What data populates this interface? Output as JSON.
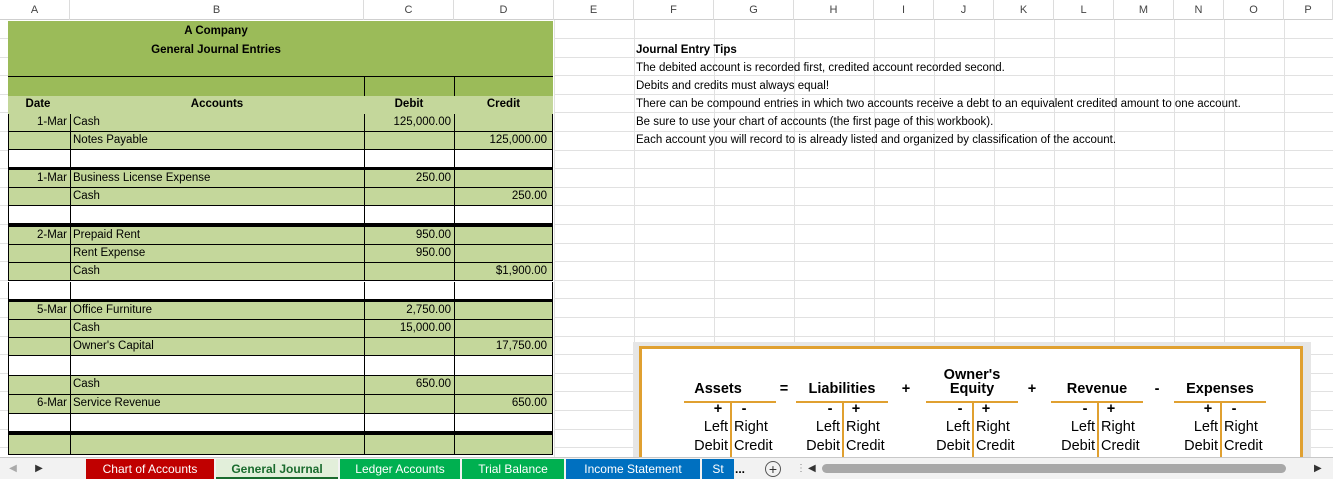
{
  "columns": [
    "A",
    "B",
    "C",
    "D",
    "E",
    "F",
    "G",
    "H",
    "I",
    "J",
    "K",
    "L",
    "M",
    "N",
    "O",
    "P"
  ],
  "journal": {
    "company": "A Company",
    "subtitle": "General Journal Entries",
    "headers": {
      "date": "Date",
      "accounts": "Accounts",
      "debit": "Debit",
      "credit": "Credit"
    },
    "rows": [
      {
        "date": "1-Mar",
        "account": "Cash",
        "debit": "125,000.00",
        "credit": ""
      },
      {
        "date": "",
        "account": "Notes Payable",
        "debit": "",
        "credit": "125,000.00"
      },
      {
        "date": "1-Mar",
        "account": "Business License Expense",
        "debit": "250.00",
        "credit": ""
      },
      {
        "date": "",
        "account": "Cash",
        "debit": "",
        "credit": "250.00"
      },
      {
        "date": "2-Mar",
        "account": "Prepaid Rent",
        "debit": "950.00",
        "credit": ""
      },
      {
        "date": "",
        "account": "Rent Expense",
        "debit": "950.00",
        "credit": ""
      },
      {
        "date": "",
        "account": "Cash",
        "debit": "",
        "credit": "$1,900.00"
      },
      {
        "date": "5-Mar",
        "account": "Office Furniture",
        "debit": "2,750.00",
        "credit": ""
      },
      {
        "date": "",
        "account": "Cash",
        "debit": "15,000.00",
        "credit": ""
      },
      {
        "date": "",
        "account": "Owner's Capital",
        "debit": "",
        "credit": "17,750.00"
      },
      {
        "date": "",
        "account": "Cash",
        "debit": "650.00",
        "credit": ""
      },
      {
        "date": "6-Mar",
        "account": "Service Revenue",
        "debit": "",
        "credit": "650.00"
      }
    ]
  },
  "tips": {
    "title": "Journal Entry Tips",
    "lines": [
      "The debited account is recorded first, credited account recorded second.",
      "Debits and credits must always equal!",
      "There can be compound entries in which two accounts receive a debt to an equivalent credited amount to one account.",
      "Be sure to use your chart of accounts (the first page of this workbook).",
      "Each account you will record to is already listed and organized by classification of the account."
    ]
  },
  "equation": {
    "groups": [
      {
        "name": "Assets",
        "signs": [
          "+",
          "-"
        ]
      },
      {
        "name": "Liabilities",
        "signs": [
          "-",
          "+"
        ]
      },
      {
        "name": "Owner's Equity",
        "name_line1": "Owner's",
        "name_line2": "Equity",
        "signs": [
          "-",
          "+"
        ]
      },
      {
        "name": "Revenue",
        "signs": [
          "-",
          "+"
        ]
      },
      {
        "name": "Expenses",
        "signs": [
          "+",
          "-"
        ]
      }
    ],
    "operators": [
      "=",
      "+",
      "+",
      "-"
    ],
    "left": "Left",
    "right": "Right",
    "debit": "Debit",
    "credit": "Credit"
  },
  "tabs": [
    {
      "label": "Chart of Accounts",
      "color": "#c00000",
      "active": false
    },
    {
      "label": "General Journal",
      "color": "#e2efda",
      "active": true
    },
    {
      "label": "Ledger Accounts",
      "color": "#00b050",
      "active": false
    },
    {
      "label": "Trial Balance",
      "color": "#00b050",
      "active": false
    },
    {
      "label": "Income Statement",
      "color": "#0070c0",
      "active": false
    },
    {
      "label": "St",
      "color": "#0070c0",
      "active": false
    }
  ],
  "tab_more": "...",
  "tab_add": "+"
}
